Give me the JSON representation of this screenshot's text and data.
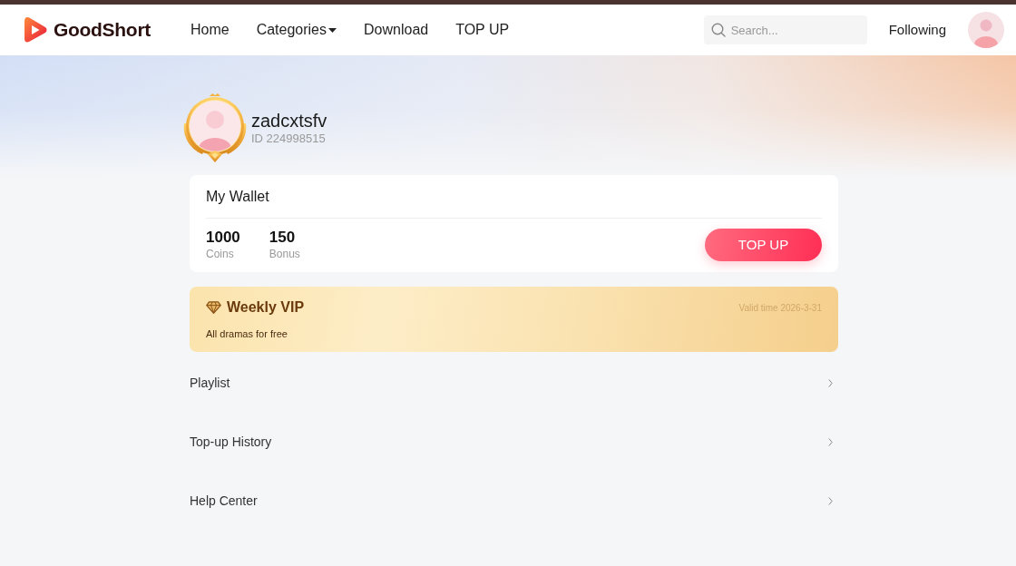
{
  "header": {
    "logo": {
      "text": "GoodShort"
    },
    "nav": [
      {
        "label": "Home",
        "dropdown": false
      },
      {
        "label": "Categories",
        "dropdown": true
      },
      {
        "label": "Download",
        "dropdown": false
      },
      {
        "label": "TOP UP",
        "dropdown": false
      }
    ],
    "search": {
      "placeholder": "Search..."
    },
    "following": "Following"
  },
  "profile": {
    "username": "zadcxtsfv",
    "id": "ID 224998515"
  },
  "wallet": {
    "title": "My Wallet",
    "balances": [
      {
        "value": "1000",
        "label": "Coins"
      },
      {
        "value": "150",
        "label": "Bonus"
      }
    ],
    "button": "TOP UP"
  },
  "vip": {
    "title": "Weekly VIP",
    "validity": "Valid time 2026-3-31",
    "description": "All dramas for free"
  },
  "menu": [
    {
      "label": "Playlist"
    },
    {
      "label": "Top-up History"
    },
    {
      "label": "Help Center"
    }
  ]
}
